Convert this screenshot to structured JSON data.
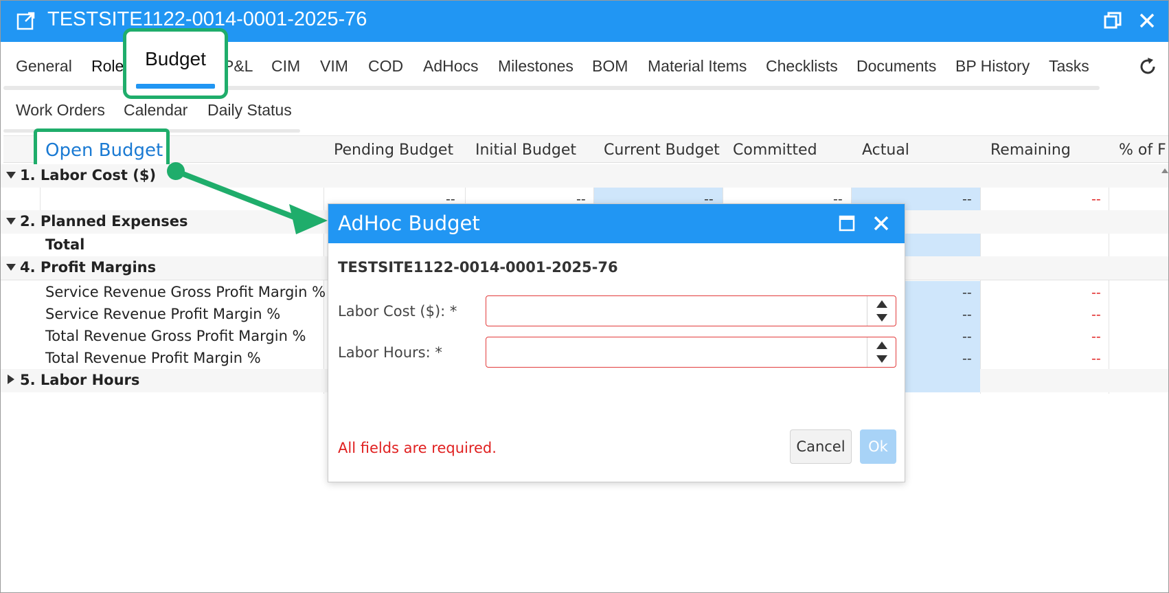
{
  "window": {
    "title": "TESTSITE1122-0014-0001-2025-76"
  },
  "tabs": {
    "row1": [
      "General",
      "Role",
      "P&L",
      "CIM",
      "VIM",
      "COD",
      "AdHocs",
      "Milestones",
      "BOM",
      "Material Items",
      "Checklists",
      "Documents",
      "BP History",
      "Tasks"
    ],
    "active": "Budget",
    "row2": [
      "Work Orders",
      "Calendar",
      "Daily Status"
    ]
  },
  "grid": {
    "open_budget_label": "Open Budget",
    "columns": [
      "Pending Budget",
      "Initial Budget",
      "Current Budget",
      "Committed",
      "Actual",
      "Remaining",
      "% of F"
    ],
    "groups": {
      "labor_cost": "1. Labor Cost ($)",
      "planned_expenses": "2. Planned Expenses",
      "total": "Total",
      "profit_margins": "4. Profit Margins",
      "labor_hours": "5. Labor Hours"
    },
    "margin_rows": [
      "Service Revenue Gross Profit Margin %",
      "Service Revenue Profit Margin %",
      "Total Revenue Gross Profit Margin %",
      "Total Revenue Profit Margin %"
    ],
    "placeholder": "--"
  },
  "dialog": {
    "title": "AdHoc Budget",
    "subtitle": "TESTSITE1122-0014-0001-2025-76",
    "labor_cost_label": "Labor Cost ($): *",
    "labor_cost_value": "",
    "labor_hours_label": "Labor Hours: *",
    "labor_hours_value": "",
    "error": "All fields are required.",
    "cancel": "Cancel",
    "ok": "Ok"
  },
  "colors": {
    "titlebar": "#2196f3",
    "annotation": "#1fad6b",
    "highlight_cell": "#cfe6fb",
    "error": "#e02020"
  }
}
